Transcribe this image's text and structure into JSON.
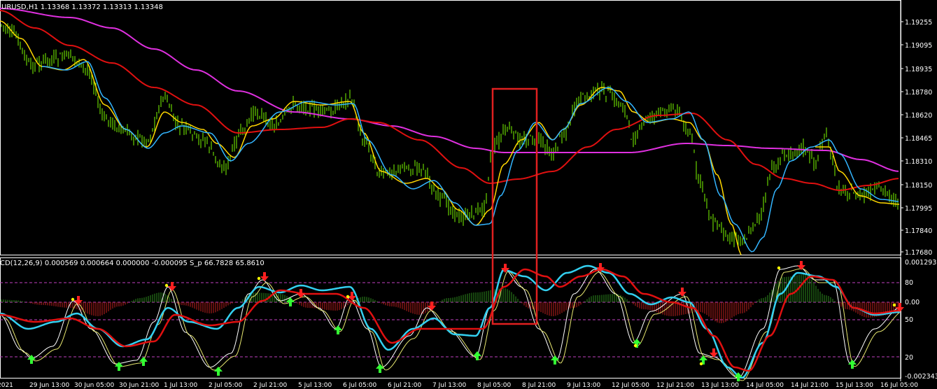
{
  "chart": {
    "symbol_info": "URUSD,H1  1.13368 1.13372 1.13313 1.13348",
    "background": "#000000",
    "candle_color": "#7CFC00",
    "ma_colors": {
      "fast_yellow": "#FFD700",
      "fast_blue": "#33B5FF",
      "mid_red": "#E01010",
      "slow_magenta": "#E030E0"
    },
    "price_axis": [
      "1.19255",
      "1.19095",
      "1.18935",
      "1.18780",
      "1.18620",
      "1.18465",
      "1.18310",
      "1.18150",
      "1.17995",
      "1.17840",
      "1.17680"
    ],
    "highlight_box_color": "#E02020"
  },
  "indicator": {
    "info": "CD(12,26,9) 0.000569 0.000664 0.000000 -0.000095  S_p 66.7828 65.8610",
    "axis": [
      "0.001293",
      "80",
      "0.00",
      "50",
      "20",
      "-0.002343"
    ],
    "level_line_color": "#C040C0",
    "histogram_up": "#2E8B1E",
    "histogram_down": "#C0201E",
    "line_colors": {
      "signal_red": "#E01010",
      "main_cyan": "#33D0F0",
      "stoch_white": "#FFFFFF",
      "stoch_yellow": "#E8E870"
    },
    "arrow_up": "#33FF33",
    "arrow_down": "#FF2020"
  },
  "time_axis": [
    "2021",
    "29 Jun 13:00",
    "30 Jun 05:00",
    "30 Jun 21:00",
    "1 Jul 13:00",
    "2 Jul 05:00",
    "2 Jul 21:00",
    "5 Jul 13:00",
    "6 Jul 05:00",
    "6 Jul 21:00",
    "7 Jul 13:00",
    "8 Jul 05:00",
    "8 Jul 21:00",
    "9 Jul 13:00",
    "12 Jul 05:00",
    "12 Jul 21:00",
    "13 Jul 13:00",
    "14 Jul 05:00",
    "14 Jul 21:00",
    "15 Jul 13:00",
    "16 Jul 05:00"
  ]
}
